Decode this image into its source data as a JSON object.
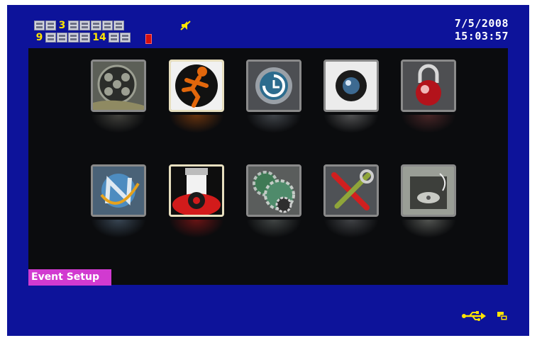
{
  "status": {
    "row1": [
      {
        "state": "off",
        "label": ""
      },
      {
        "state": "off",
        "label": ""
      },
      {
        "state": "on",
        "label": "3"
      },
      {
        "state": "off",
        "label": ""
      },
      {
        "state": "off",
        "label": ""
      },
      {
        "state": "off",
        "label": ""
      },
      {
        "state": "off",
        "label": ""
      },
      {
        "state": "off",
        "label": ""
      }
    ],
    "row2": [
      {
        "state": "on",
        "label": "9"
      },
      {
        "state": "off",
        "label": ""
      },
      {
        "state": "off",
        "label": ""
      },
      {
        "state": "off",
        "label": ""
      },
      {
        "state": "off",
        "label": ""
      },
      {
        "state": "on",
        "label": "14"
      },
      {
        "state": "off",
        "label": ""
      },
      {
        "state": "off",
        "label": ""
      }
    ],
    "date": "7/5/2008",
    "time": "15:03:57"
  },
  "menu": {
    "selected_label": "Event Setup",
    "items": [
      {
        "icon": "film-reel-icon"
      },
      {
        "icon": "running-man-icon",
        "selected": true
      },
      {
        "icon": "clock-refresh-icon"
      },
      {
        "icon": "camera-lens-icon"
      },
      {
        "icon": "padlock-icon"
      },
      {
        "icon": "network-globe-icon"
      },
      {
        "icon": "dome-camera-icon",
        "selected": true
      },
      {
        "icon": "gears-icon"
      },
      {
        "icon": "tools-icon"
      },
      {
        "icon": "hard-drive-icon"
      }
    ]
  },
  "colors": {
    "background": "#0d139a",
    "panel": "#0b0c0e",
    "label_bg": "#d13ad0",
    "channel_on": "#ffe400",
    "record": "#d41010"
  },
  "tray": {
    "usb": "usb-icon",
    "storage": "storage-icon"
  }
}
